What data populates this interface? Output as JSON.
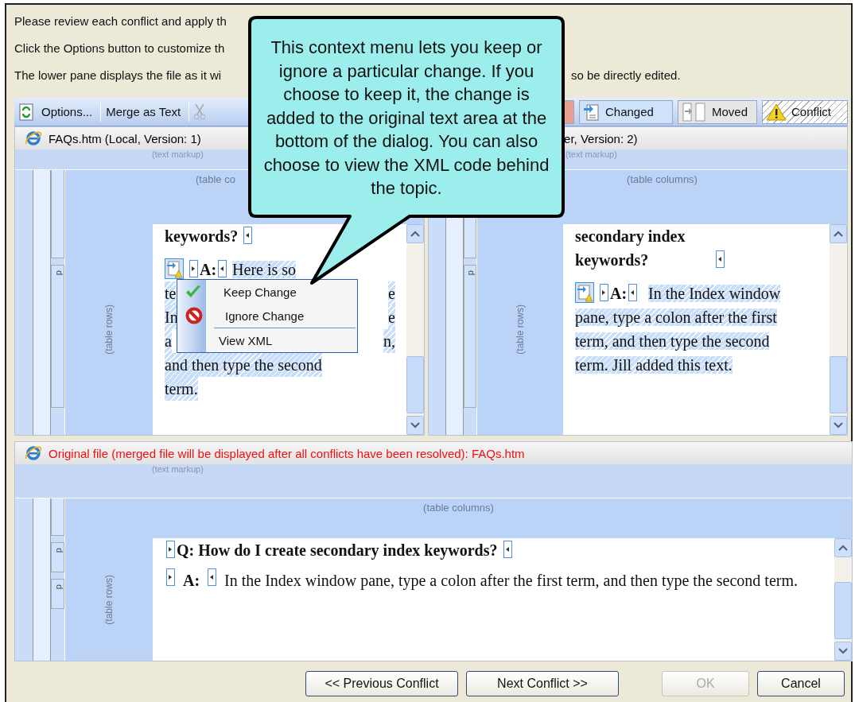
{
  "instructions": [
    {
      "left": "Please review each conflict and apply th"
    },
    {
      "left": "Click the Options button to customize th"
    },
    {
      "left": "The lower pane displays the file as it wi",
      "right": "so be directly edited."
    }
  ],
  "toolbar": {
    "commands": [
      {
        "label": "Options...",
        "kind": "options"
      },
      {
        "label": "Merge as Text",
        "kind": "merge"
      },
      {
        "kind": "cut"
      }
    ],
    "legend": [
      {
        "kind": "deleted"
      },
      {
        "label": "Changed",
        "kind": "changed"
      },
      {
        "label": "Moved",
        "kind": "moved"
      },
      {
        "label": "Conflict",
        "kind": "conflict"
      }
    ]
  },
  "local_pane": {
    "header": "FAQs.htm (Local, Version: 1)",
    "markup_label": "(text markup)",
    "columns_label": "(table co",
    "rows_label": "(table rows)",
    "para_labels": [
      "p"
    ],
    "heading": "keywords?",
    "answer_marker": "A:",
    "answer_start": "Here is so",
    "answer_lines": [
      {
        "left": "te",
        "right": "e"
      },
      {
        "left": "In",
        "right": "e"
      },
      {
        "left": "a",
        "right": "n,"
      },
      {
        "left": "and then type the second"
      },
      {
        "left": "term."
      }
    ]
  },
  "server_pane": {
    "header": "er, Version: 2)",
    "markup_label": "(text markup)",
    "columns_label": "(table columns)",
    "rows_label": "(table rows)",
    "para_labels": [
      "p"
    ],
    "heading": "secondary index keywords?",
    "answer_marker": "A:",
    "answer": "In the Index window pane, type a colon after the first term, and then type the second term. Jill added this text."
  },
  "original_pane": {
    "header": "Original file (merged file will be displayed after all conflicts have been resolved): FAQs.htm",
    "markup_label": "(text markup)",
    "columns_label": "(table columns)",
    "rows_label": "(table rows)",
    "para_labels": [
      "p",
      "p"
    ],
    "question": "Q: How do I create secondary index keywords?",
    "answer_marker": "A:",
    "answer": "In the Index window pane, type a colon after the first term, and then type the second term."
  },
  "context_menu": [
    {
      "label": "Keep Change",
      "kind": "keep"
    },
    {
      "label": "Ignore Change",
      "kind": "ignore"
    },
    {
      "kind": "separator"
    },
    {
      "label": "View XML",
      "kind": "plain"
    }
  ],
  "callout": {
    "text": "This context menu lets you keep or ignore a particular change. If you choose to keep it, the change is added to the original text area at the bottom of the dialog. You can also choose to view the XML code behind the topic."
  },
  "buttons": [
    {
      "label": "<< Previous Conflict",
      "disabled": false
    },
    {
      "label": "Next Conflict >>",
      "disabled": false
    },
    {
      "label": "OK",
      "disabled": true
    },
    {
      "label": "Cancel",
      "disabled": false
    }
  ]
}
